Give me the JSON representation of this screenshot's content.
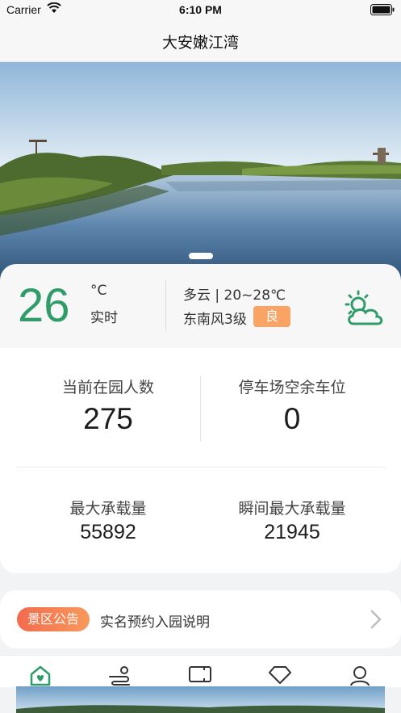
{
  "status": {
    "carrier": "Carrier",
    "time": "6:10 PM"
  },
  "nav": {
    "title": "大安嫩江湾"
  },
  "weather": {
    "temp": "26",
    "unit": "°C",
    "realtime_label": "实时",
    "condition": "多云 | 20~28℃",
    "wind": "东南风3级",
    "aqi": "良",
    "icon": "partly-cloudy-icon",
    "accent_color": "#2f9c6a"
  },
  "stats": {
    "visitors_label": "当前在园人数",
    "visitors_value": "275",
    "parking_label": "停车场空余车位",
    "parking_value": "0",
    "max_capacity_label": "最大承载量",
    "max_capacity_value": "55892",
    "instant_capacity_label": "瞬间最大承载量",
    "instant_capacity_value": "21945"
  },
  "notice": {
    "badge": "景区公告",
    "text": "实名预约入园说明"
  },
  "tabs": [
    {
      "icon": "home-icon",
      "active": true
    },
    {
      "icon": "route-icon",
      "active": false
    },
    {
      "icon": "ticket-icon",
      "active": false
    },
    {
      "icon": "diamond-icon",
      "active": false
    },
    {
      "icon": "user-icon",
      "active": false
    }
  ]
}
